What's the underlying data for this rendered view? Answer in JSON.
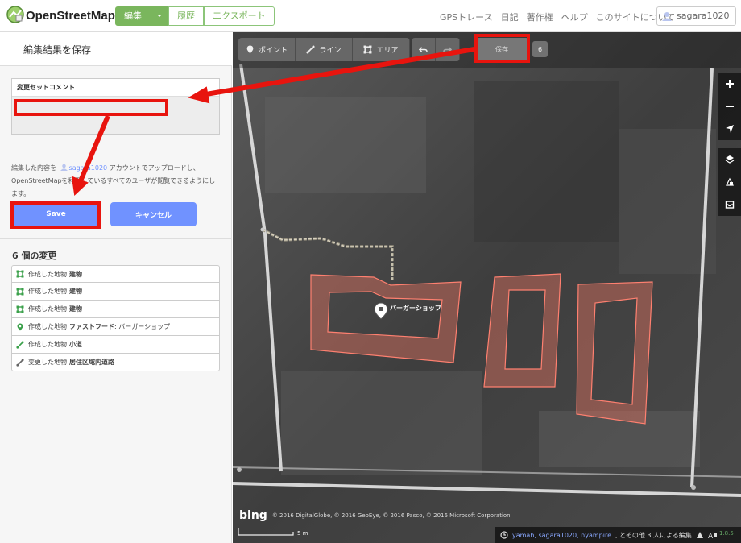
{
  "header": {
    "brand": "OpenStreetMap",
    "edit_label": "編集",
    "history_label": "履歴",
    "export_label": "エクスポート",
    "nav": [
      "GPSトレース",
      "日記",
      "著作権",
      "ヘルプ",
      "このサイトについて"
    ],
    "user": "sagara1020"
  },
  "sidebar": {
    "title": "編集結果を保存",
    "comment_label": "変更セットコメント",
    "comment_value": "",
    "upload_info_prefix": "編集した内容を",
    "upload_user": "sagara1020",
    "upload_info_suffix": "アカウントでアップロードし、OpenStreetMapを利用しているすべてのユーザが閲覧できるようにします。",
    "save_label": "Save",
    "cancel_label": "キャンセル",
    "changes_title": "6 個の変更",
    "changes": [
      {
        "icon": "area-icon",
        "verb": "作成した地物",
        "feature": "建物"
      },
      {
        "icon": "area-icon",
        "verb": "作成した地物",
        "feature": "建物"
      },
      {
        "icon": "area-icon",
        "verb": "作成した地物",
        "feature": "建物"
      },
      {
        "icon": "point-icon",
        "verb": "作成した地物",
        "feature": "ファストフード",
        "detail": ": バーガーショップ"
      },
      {
        "icon": "line-icon",
        "verb": "作成した地物",
        "feature": "小道"
      },
      {
        "icon": "line-modified-icon",
        "verb": "変更した地物",
        "feature": "居住区域内道路"
      }
    ]
  },
  "map": {
    "modes": [
      "ポイント",
      "ライン",
      "エリア"
    ],
    "save_label": "保存",
    "save_count": "6",
    "poi_label": "バーガーショップ",
    "attribution": "© 2016 DigitalGlobe, © 2016 GeoEye, © 2016 Pasco, © 2016 Microsoft Corporation",
    "bing": "bing",
    "scale": "5 m",
    "contributors": "yamah, sagara1020, nyampire",
    "contributors_suffix": ", とその他 3 人による編集",
    "version": "1.8.5"
  },
  "colors": {
    "accent": "#7ab65d",
    "button_blue": "#7092ff",
    "annotation_red": "#e8140e"
  }
}
